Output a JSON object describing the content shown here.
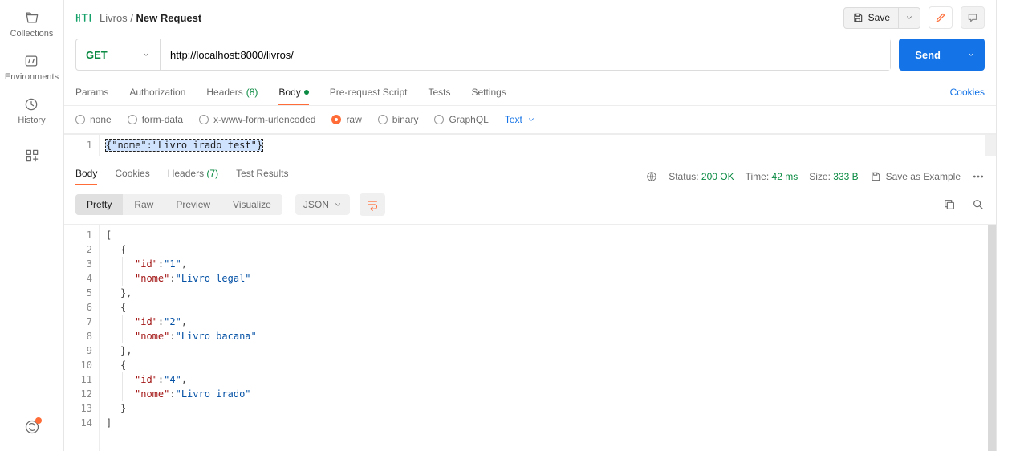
{
  "rail": {
    "collections": "Collections",
    "environments": "Environments",
    "history": "History"
  },
  "breadcrumb": {
    "parent": "Livros",
    "current": "New Request"
  },
  "actions": {
    "save": "Save",
    "send": "Send"
  },
  "request": {
    "method": "GET",
    "url": "http://localhost:8000/livros/"
  },
  "req_tabs": {
    "params": "Params",
    "authorization": "Authorization",
    "headers_label": "Headers",
    "headers_count": "(8)",
    "body": "Body",
    "prerequest": "Pre-request Script",
    "tests": "Tests",
    "settings": "Settings",
    "cookies": "Cookies"
  },
  "body_types": {
    "none": "none",
    "formdata": "form-data",
    "urlenc": "x-www-form-urlencoded",
    "raw": "raw",
    "binary": "binary",
    "graphql": "GraphQL",
    "lang": "Text"
  },
  "req_body": {
    "line1_num": "1",
    "line1_text": "{\"nome\":\"Livro irado test\"}"
  },
  "resp_tabs": {
    "body": "Body",
    "cookies": "Cookies",
    "headers_label": "Headers",
    "headers_count": "(7)",
    "tests": "Test Results"
  },
  "resp_meta": {
    "status_label": "Status:",
    "status_value": "200 OK",
    "time_label": "Time:",
    "time_value": "42 ms",
    "size_label": "Size:",
    "size_value": "333 B",
    "save_example": "Save as Example"
  },
  "resp_toolbar": {
    "pretty": "Pretty",
    "raw": "Raw",
    "preview": "Preview",
    "visualize": "Visualize",
    "format": "JSON"
  },
  "resp_lines": {
    "n1": "1",
    "n2": "2",
    "n3": "3",
    "n4": "4",
    "n5": "5",
    "n6": "6",
    "n7": "7",
    "n8": "8",
    "n9": "9",
    "n10": "10",
    "n11": "11",
    "n12": "12",
    "n13": "13",
    "n14": "14"
  },
  "resp_json": {
    "open_bracket": "[",
    "open_brace": "{",
    "id_label": "\"id\"",
    "nome_label": "\"nome\"",
    "colon": ": ",
    "comma": ",",
    "close_brace_c": "},",
    "close_brace": "}",
    "close_bracket": "]",
    "r1_id": "\"1\"",
    "r1_nome": "\"Livro legal\"",
    "r2_id": "\"2\"",
    "r2_nome": "\"Livro bacana\"",
    "r3_id": "\"4\"",
    "r3_nome": "\"Livro irado\""
  }
}
